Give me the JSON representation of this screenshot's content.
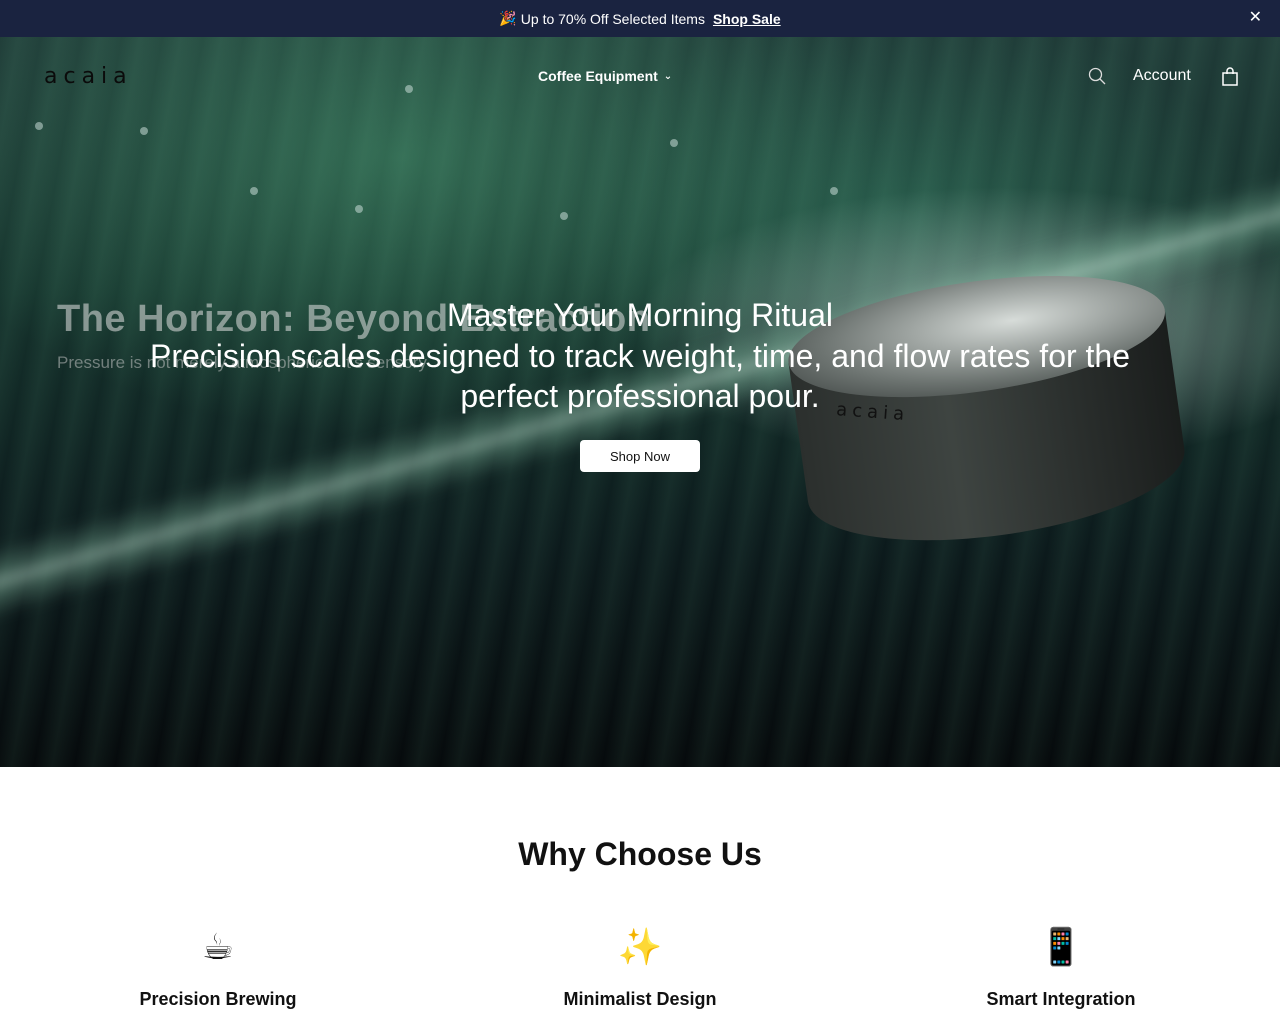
{
  "announcement": {
    "emoji": "🎉",
    "text": "Up to 70% Off Selected Items",
    "link": "Shop Sale",
    "close": "✕"
  },
  "header": {
    "logo": "acaia",
    "nav_item": "Coffee Equipment",
    "nav_chevron": "⌄",
    "account": "Account",
    "icons": [
      "search-icon",
      "shopping-bag-icon"
    ]
  },
  "hero": {
    "background_headline": "The Horizon: Beyond Extraction",
    "background_subline": "Pressure is not merely atmospheric – it's sensory",
    "product_mark": "acaia",
    "title": "Master Your Morning Ritual",
    "subtitle": "Precision scales designed to track weight, time, and flow rates for the perfect professional pour.",
    "cta": "Shop Now"
  },
  "why": {
    "title": "Why Choose Us",
    "features": [
      {
        "icon": "☕",
        "label": "Precision Brewing"
      },
      {
        "icon": "✨",
        "label": "Minimalist Design"
      },
      {
        "icon": "📱",
        "label": "Smart Integration"
      }
    ]
  },
  "colors": {
    "announcement_bg": "#1a2340",
    "button_bg": "#ffffff",
    "text_dark": "#111111"
  }
}
